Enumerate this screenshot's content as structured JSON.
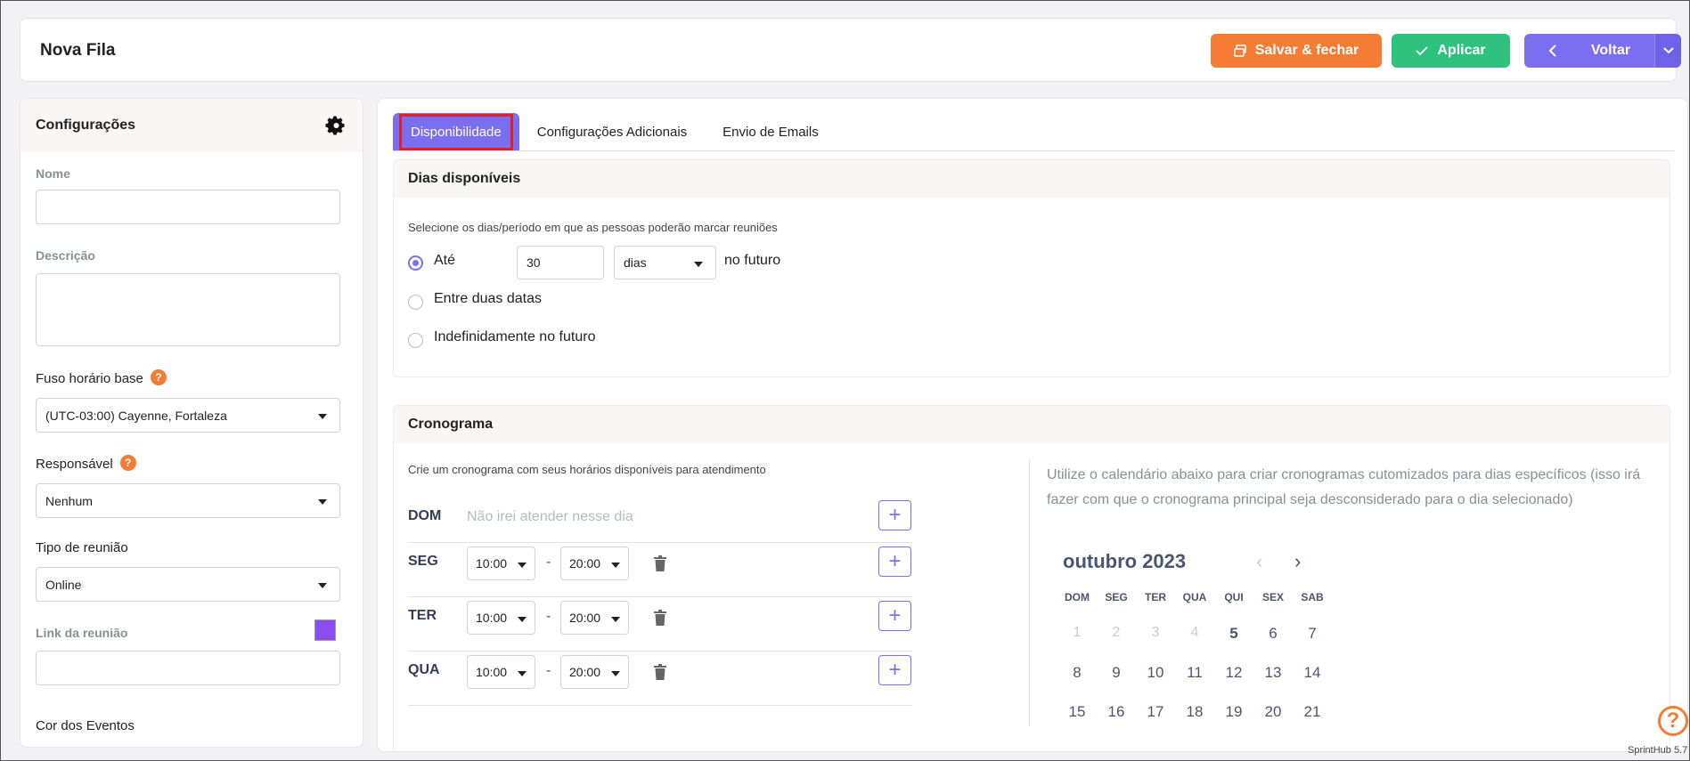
{
  "header": {
    "title": "Nova Fila",
    "save_close_label": "Salvar & fechar",
    "apply_label": "Aplicar",
    "back_label": "Voltar"
  },
  "sidebar": {
    "title": "Configurações",
    "name_label": "Nome",
    "name_value": "",
    "description_label": "Descrição",
    "description_value": "",
    "timezone_label": "Fuso horário base",
    "timezone_value": "(UTC-03:00) Cayenne, Fortaleza",
    "owner_label": "Responsável",
    "owner_value": "Nenhum",
    "meeting_type_label": "Tipo de reunião",
    "meeting_type_value": "Online",
    "meeting_link_label": "Link da reunião",
    "meeting_link_value": "",
    "event_color_label": "Cor dos Eventos",
    "event_color": "#8b4cf0"
  },
  "tabs": [
    {
      "label": "Disponibilidade",
      "active": true
    },
    {
      "label": "Configurações Adicionais",
      "active": false
    },
    {
      "label": "Envio de Emails",
      "active": false
    }
  ],
  "availability": {
    "title": "Dias disponíveis",
    "subtitle": "Selecione os dias/período em que as pessoas poderão marcar reuniões",
    "option_until": "Até",
    "until_value": "30",
    "until_unit": "dias",
    "until_suffix": "no futuro",
    "option_between": "Entre duas datas",
    "option_indefinite": "Indefinidamente no futuro",
    "selected": "Até"
  },
  "schedule": {
    "title": "Cronograma",
    "subtitle": "Crie um cronograma com seus horários disponíveis para atendimento",
    "dom_label": "DOM",
    "dom_off_text": "Não irei atender nesse dia",
    "seg_label": "SEG",
    "seg_start": "10:00",
    "seg_end": "20:00",
    "ter_label": "TER",
    "ter_start": "10:00",
    "ter_end": "20:00",
    "qua_label": "QUA",
    "qua_start": "10:00",
    "qua_end": "20:00",
    "separator": "-",
    "plus": "+"
  },
  "calendar": {
    "note": "Utilize o calendário abaixo para criar cronogramas cutomizados para dias específicos (isso irá fazer com que o cronograma principal seja desconsiderado para o dia selecionado)",
    "month": "outubro 2023",
    "prev_icon": "‹",
    "next_icon": "›",
    "weekdays": [
      "DOM",
      "SEG",
      "TER",
      "QUA",
      "QUI",
      "SEX",
      "SAB"
    ],
    "week1": [
      "1",
      "2",
      "3",
      "4",
      "5",
      "6",
      "7"
    ],
    "week2": [
      "8",
      "9",
      "10",
      "11",
      "12",
      "13",
      "14"
    ],
    "week3": [
      "15",
      "16",
      "17",
      "18",
      "19",
      "20",
      "21"
    ]
  },
  "footer": {
    "help_icon": "?",
    "version": "SprintHub 5.7"
  },
  "colors": {
    "primary": "#7b6ff0",
    "save": "#f47c34",
    "apply": "#2ec27e"
  }
}
